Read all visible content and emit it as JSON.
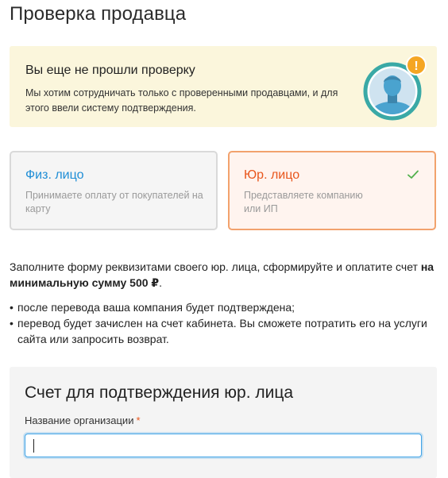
{
  "page": {
    "title": "Проверка продавца"
  },
  "notice": {
    "title": "Вы еще не прошли проверку",
    "text": "Мы хотим сотрудничать только с проверенными продавцами, и для этого ввели систему подтверждения.",
    "badge": "!"
  },
  "cards": {
    "physical": {
      "title": "Физ. лицо",
      "description": "Принимаете оплату от покупателей на карту",
      "selected": false
    },
    "legal": {
      "title": "Юр. лицо",
      "description": "Представляете компанию или ИП",
      "selected": true
    }
  },
  "intro": {
    "text": "Заполните форму реквизитами своего юр. лица, сформируйте и оплатите счет ",
    "bold": "на минимальную сумму 500 ₽",
    "suffix": "."
  },
  "bullets": [
    "после перевода ваша компания будет подтверждена;",
    "перевод будет зачислен на счет кабинета. Вы сможете потратить его на услуги сайта или запросить возврат."
  ],
  "form": {
    "title": "Счет для подтверждения юр. лица",
    "org_label": "Название организации",
    "required_mark": "*",
    "org_value": ""
  },
  "colors": {
    "accent_orange": "#e8561c",
    "accent_blue": "#1f8ed6",
    "notice_bg": "#fbf6dc",
    "check_green": "#52b04c",
    "avatar_teal": "#3aa9a6",
    "badge_orange": "#f5a623"
  }
}
